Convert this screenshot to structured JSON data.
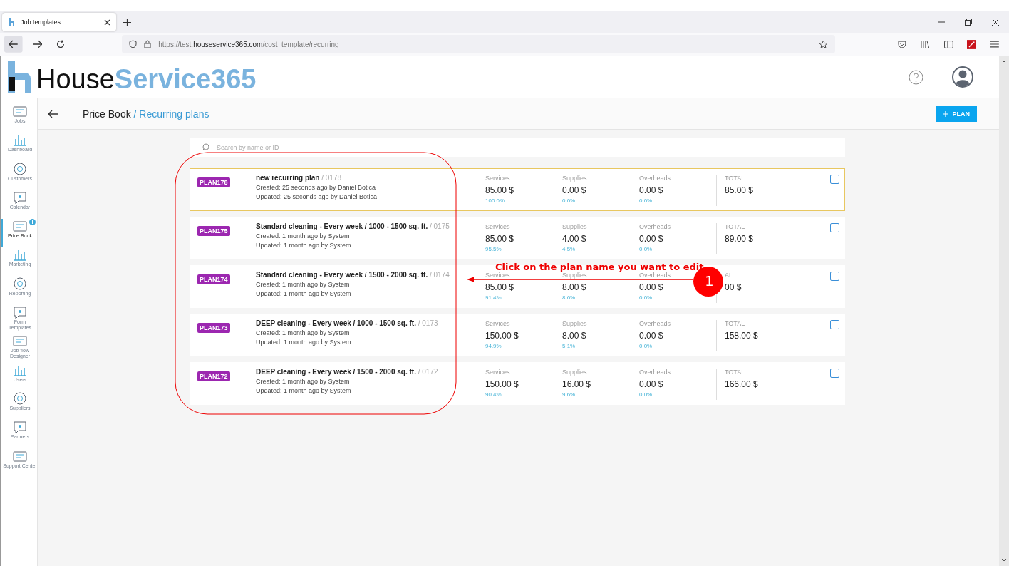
{
  "browser": {
    "tab_title": "Job templates",
    "url": "https://test.**houseservice365.com**/cost_template/recurring"
  },
  "logo": {
    "dark": "House",
    "light": "Service365"
  },
  "breadcrumb": {
    "root": "Price Book",
    "current": "/ Recurring plans"
  },
  "add_button": "PLAN",
  "sidebar": {
    "items": [
      {
        "label": "Jobs",
        "selected": false,
        "badge": false
      },
      {
        "label": "Dashboard",
        "selected": false,
        "badge": false
      },
      {
        "label": "Customers",
        "selected": false,
        "badge": false
      },
      {
        "label": "Calendar",
        "selected": false,
        "badge": false
      },
      {
        "label": "Price Book",
        "selected": true,
        "badge": true
      },
      {
        "label": "Marketing",
        "selected": false,
        "badge": false
      },
      {
        "label": "Reporting",
        "selected": false,
        "badge": false
      },
      {
        "label": "Form Templates",
        "selected": false,
        "badge": false
      },
      {
        "label": "Job flow Designer",
        "selected": false,
        "badge": false
      },
      {
        "label": "Users",
        "selected": false,
        "badge": false
      },
      {
        "label": "Suppliers",
        "selected": false,
        "badge": false
      },
      {
        "label": "Partners",
        "selected": false,
        "badge": false
      },
      {
        "label": "Support Center",
        "selected": false,
        "badge": false
      }
    ]
  },
  "search": {
    "placeholder": "Search by name or ID"
  },
  "plans": [
    {
      "code": "PLAN178",
      "name": "new recurring plan",
      "number": "/ 0178",
      "created": "Created: 25 seconds ago by Daniel Botica",
      "updated": "Updated: 25 seconds ago by Daniel Botica",
      "selected": true,
      "checked": false,
      "costs": [
        {
          "label": "Services",
          "value": "85.00 $",
          "share": "100.0%"
        },
        {
          "label": "Supplies",
          "value": "0.00 $",
          "share": "0.0%"
        },
        {
          "label": "Overheads",
          "value": "0.00 $",
          "share": "0.0%"
        }
      ],
      "total_label": "TOTAL",
      "total": "85.00 $"
    },
    {
      "code": "PLAN175",
      "name": "Standard cleaning - Every week / 1000 - 1500 sq. ft.",
      "number": "/ 0175",
      "created": "Created: 1 month ago by System",
      "updated": "Updated: 1 month ago by System",
      "selected": false,
      "checked": false,
      "costs": [
        {
          "label": "Services",
          "value": "85.00 $",
          "share": "95.5%"
        },
        {
          "label": "Supplies",
          "value": "4.00 $",
          "share": "4.5%"
        },
        {
          "label": "Overheads",
          "value": "0.00 $",
          "share": "0.0%"
        }
      ],
      "total_label": "TOTAL",
      "total": "89.00 $"
    },
    {
      "code": "PLAN174",
      "name": "Standard cleaning - Every week / 1500 - 2000 sq. ft.",
      "number": "/ 0174",
      "created": "Created: 1 month ago by System",
      "updated": "Updated: 1 month ago by System",
      "selected": false,
      "checked": false,
      "costs": [
        {
          "label": "Services",
          "value": "85.00 $",
          "share": "91.4%"
        },
        {
          "label": "Supplies",
          "value": "8.00 $",
          "share": "8.6%"
        },
        {
          "label": "Overheads",
          "value": "0.00 $",
          "share": "0.0%"
        }
      ],
      "total_label": "AL",
      "total": "00 $"
    },
    {
      "code": "PLAN173",
      "name": "DEEP cleaning - Every week / 1000 - 1500 sq. ft.",
      "number": "/ 0173",
      "created": "Created: 1 month ago by System",
      "updated": "Updated: 1 month ago by System",
      "selected": false,
      "checked": false,
      "costs": [
        {
          "label": "Services",
          "value": "150.00 $",
          "share": "94.9%"
        },
        {
          "label": "Supplies",
          "value": "8.00 $",
          "share": "5.1%"
        },
        {
          "label": "Overheads",
          "value": "0.00 $",
          "share": "0.0%"
        }
      ],
      "total_label": "TOTAL",
      "total": "158.00 $"
    },
    {
      "code": "PLAN172",
      "name": "DEEP cleaning - Every week / 1500 - 2000 sq. ft.",
      "number": "/ 0172",
      "created": "Created: 1 month ago by System",
      "updated": "Updated: 1 month ago by System",
      "selected": false,
      "checked": false,
      "costs": [
        {
          "label": "Services",
          "value": "150.00 $",
          "share": "90.4%"
        },
        {
          "label": "Supplies",
          "value": "16.00 $",
          "share": "9.6%"
        },
        {
          "label": "Overheads",
          "value": "0.00 $",
          "share": "0.0%"
        }
      ],
      "total_label": "TOTAL",
      "total": "166.00 $"
    }
  ],
  "annotation": {
    "callout": "Click on the plan name you want to edit",
    "step": "1"
  }
}
